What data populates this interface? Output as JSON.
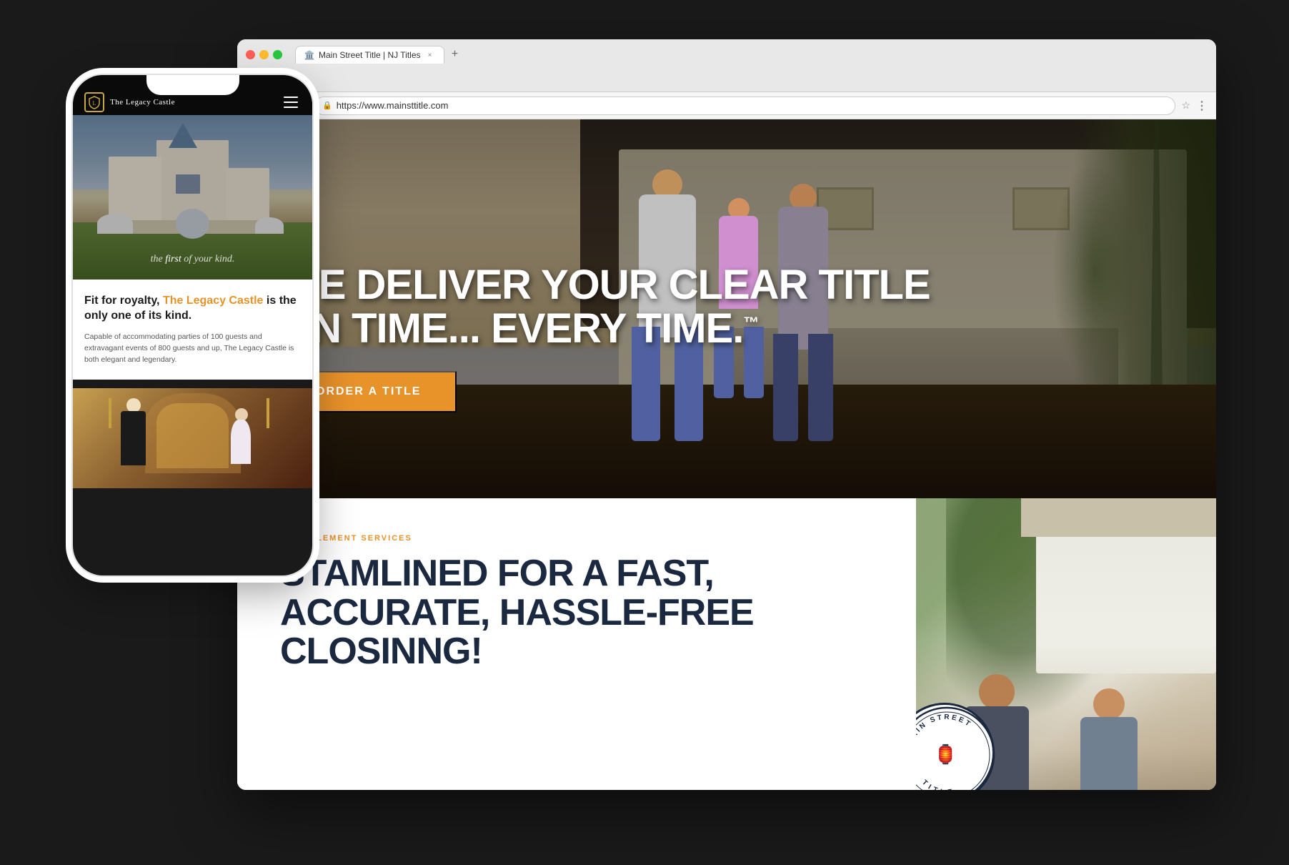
{
  "browser": {
    "tab_label": "Main Street Title | NJ Titles",
    "tab_favicon": "🏛️",
    "url": "https://www.mainsttitle.com",
    "close_label": "×",
    "new_tab_label": "+"
  },
  "website": {
    "hero": {
      "headline_line1": "WE DELIVER YOUR CLEAR TITLE",
      "headline_line2": "ON TIME... EVERY TIME.",
      "trademark": "™",
      "cta_label": "ORDER A TITLE"
    },
    "services": {
      "tag": "& SETTLEMENT SERVICES",
      "headline_line1": "AMLINED FOR A FAST,",
      "headline_line2": "RATE, HASSLE-FREE",
      "headline_line3": "NG!"
    },
    "badge": {
      "top_text": "MAIN STREET",
      "bottom_text": "TITLE",
      "icon": "🏮"
    }
  },
  "phone": {
    "logo_text": "The Legacy Castle",
    "logo_icon": "L",
    "hero_subtext": "the first of your kind.",
    "content_heading_normal": "Fit for royalty,",
    "content_heading_orange": "The Legacy Castle",
    "content_heading_end": "is the only one of its kind.",
    "content_body": "Capable of accommodating parties of 100 guests and extravagant events of 800 guests and up, The Legacy Castle is both elegant and legendary."
  }
}
